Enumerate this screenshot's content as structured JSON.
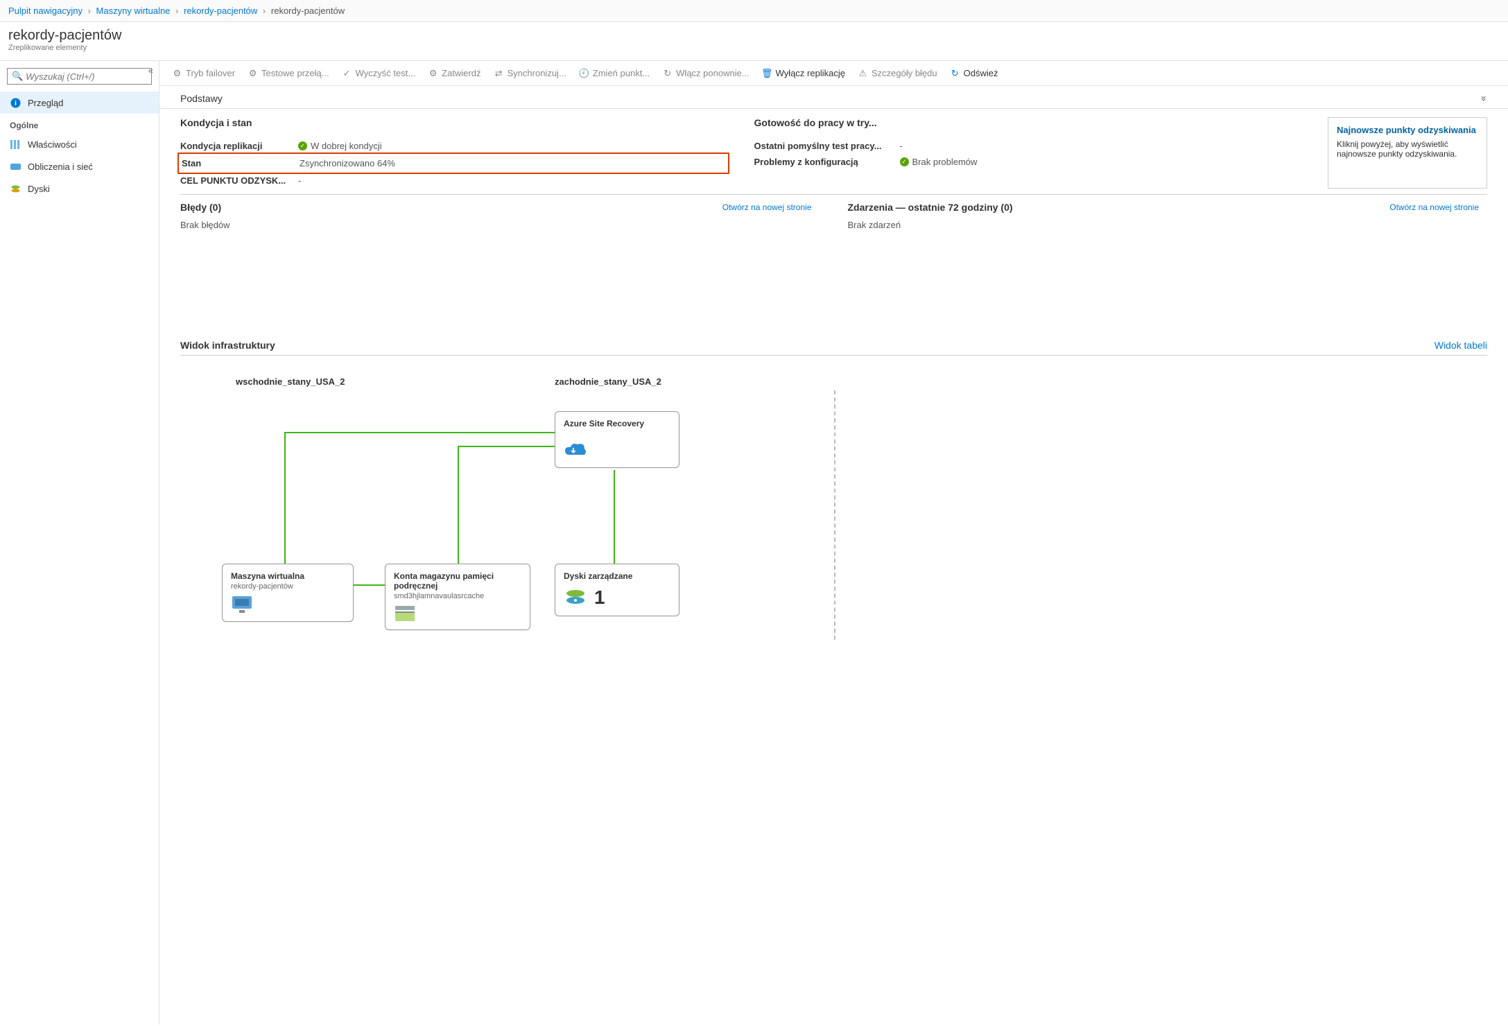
{
  "breadcrumb": {
    "items": [
      {
        "label": "Pulpit nawigacyjny",
        "link": true
      },
      {
        "label": "Maszyny wirtualne",
        "link": true
      },
      {
        "label": "rekordy-pacjentów",
        "link": true
      },
      {
        "label": "rekordy-pacjentów",
        "link": false
      }
    ]
  },
  "header": {
    "title": "rekordy-pacjentów",
    "subtitle": "Zreplikowane elementy"
  },
  "search": {
    "placeholder": "Wyszukaj (Ctrl+/)"
  },
  "sidebar": {
    "overview": "Przegląd",
    "section": "Ogólne",
    "items": [
      {
        "label": "Właściwości"
      },
      {
        "label": "Obliczenia i sieć"
      },
      {
        "label": "Dyski"
      }
    ]
  },
  "toolbar": {
    "failover": "Tryb failover",
    "testFailover": "Testowe przełą...",
    "cleanupTest": "Wyczyść test...",
    "commit": "Zatwierdź",
    "resync": "Synchronizuj...",
    "changePoint": "Zmień punkt...",
    "reEnable": "Włącz ponownie...",
    "disableRepl": "Wyłącz replikację",
    "errorDetails": "Szczegóły błędu",
    "refresh": "Odśwież"
  },
  "essentials": {
    "title": "Podstawy"
  },
  "health": {
    "title": "Kondycja i stan",
    "replHealthLabel": "Kondycja replikacji",
    "replHealthValue": "W dobrej kondycji",
    "statusLabel": "Stan",
    "statusValue": "Zsynchronizowano 64%",
    "rpoLabel": "CEL PUNKTU ODZYSK...",
    "rpoValue": "-"
  },
  "readiness": {
    "title": "Gotowość do pracy w try...",
    "lastTestLabel": "Ostatni pomyślny test pracy...",
    "lastTestValue": "-",
    "configLabel": "Problemy z konfiguracją",
    "configValue": "Brak problemów"
  },
  "recovery": {
    "title": "Najnowsze punkty odzyskiwania",
    "text": "Kliknij powyżej, aby wyświetlić najnowsze punkty odzyskiwania."
  },
  "errors": {
    "title": "Błędy (0)",
    "link": "Otwórz na nowej stronie",
    "body": "Brak błędów"
  },
  "events": {
    "title": "Zdarzenia — ostatnie 72 godziny (0)",
    "link": "Otwórz na nowej stronie",
    "body": "Brak zdarzeń"
  },
  "infra": {
    "tab1": "Widok infrastruktury",
    "tab2": "Widok tabeli",
    "regionLeft": "wschodnie_stany_USA_2",
    "regionRight": "zachodnie_stany_USA_2",
    "nodes": {
      "vm": {
        "title": "Maszyna wirtualna",
        "sub": "rekordy-pacjentów"
      },
      "cache": {
        "title": "Konta magazynu pamięci podręcznej",
        "sub": "smd3hjlamnavaulasrcache"
      },
      "asr": {
        "title": "Azure Site Recovery",
        "sub": ""
      },
      "disks": {
        "title": "Dyski zarządzane",
        "count": "1"
      }
    }
  }
}
